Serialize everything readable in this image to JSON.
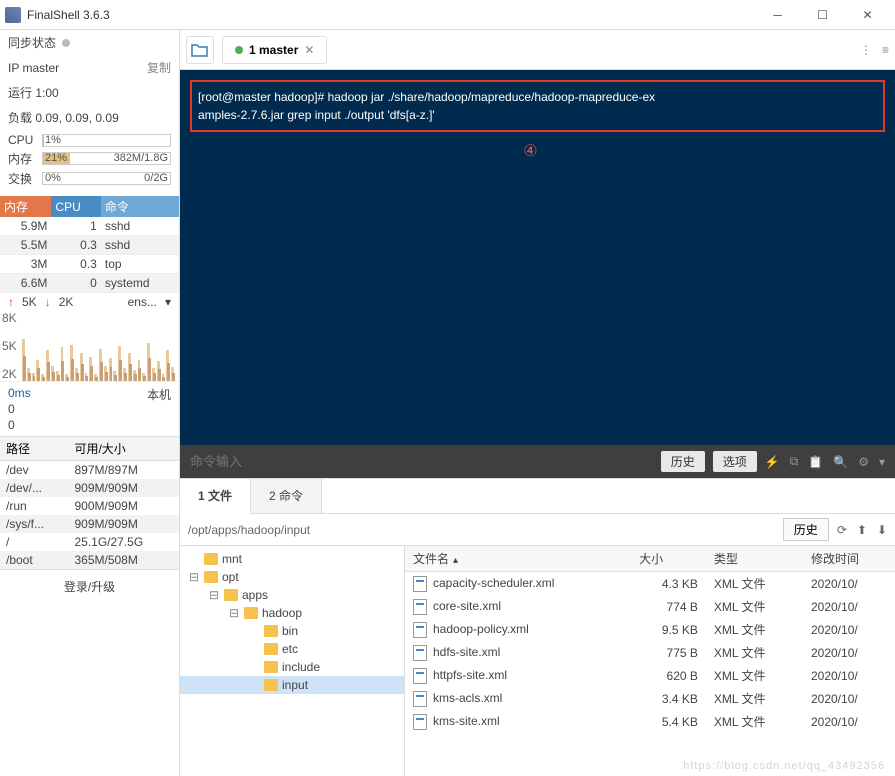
{
  "titlebar": {
    "title": "FinalShell 3.6.3"
  },
  "sidebar": {
    "sync_label": "同步状态",
    "ip_label": "IP master",
    "copy_label": "复制",
    "uptime_label": "运行 1:00",
    "load_label": "负载 0.09, 0.09, 0.09",
    "cpu": {
      "label": "CPU",
      "pct": "1%",
      "pct_num": 1
    },
    "mem": {
      "label": "内存",
      "pct": "21%",
      "pct_num": 21,
      "extra": "382M/1.8G"
    },
    "swap": {
      "label": "交换",
      "pct": "0%",
      "pct_num": 0,
      "extra": "0/2G"
    },
    "proc_headers": [
      "内存",
      "CPU",
      "命令"
    ],
    "procs": [
      {
        "mem": "5.9M",
        "cpu": "1",
        "cmd": "sshd"
      },
      {
        "mem": "5.5M",
        "cpu": "0.3",
        "cmd": "sshd"
      },
      {
        "mem": "3M",
        "cpu": "0.3",
        "cmd": "top"
      },
      {
        "mem": "6.6M",
        "cpu": "0",
        "cmd": "systemd"
      }
    ],
    "net_up": "5K",
    "net_down": "2K",
    "net_iface": "ens...",
    "spark_labels": [
      "8K",
      "5K",
      "2K"
    ],
    "latency": {
      "ms": "0ms",
      "host": "本机",
      "v1": "0",
      "v2": "0"
    },
    "disk_headers": [
      "路径",
      "可用/大小"
    ],
    "disks": [
      {
        "path": "/dev",
        "size": "897M/897M"
      },
      {
        "path": "/dev/...",
        "size": "909M/909M"
      },
      {
        "path": "/run",
        "size": "900M/909M"
      },
      {
        "path": "/sys/f...",
        "size": "909M/909M"
      },
      {
        "path": "/",
        "size": "25.1G/27.5G"
      },
      {
        "path": "/boot",
        "size": "365M/508M"
      }
    ],
    "login": "登录/升级"
  },
  "tabs": {
    "label": "1 master"
  },
  "terminal": {
    "line1": "[root@master hadoop]# hadoop jar ./share/hadoop/mapreduce/hadoop-mapreduce-ex",
    "line2": "amples-2.7.6.jar grep input ./output 'dfs[a-z.]'",
    "annotation": "④"
  },
  "cmdbar": {
    "placeholder": "命令输入",
    "history": "历史",
    "options": "选项"
  },
  "bottom_tabs": {
    "tab1": "1 文件",
    "tab2": "2 命令"
  },
  "pathbar": {
    "path": "/opt/apps/hadoop/input",
    "history": "历史"
  },
  "tree": [
    {
      "depth": 0,
      "toggle": "",
      "label": "mnt"
    },
    {
      "depth": 0,
      "toggle": "⊟",
      "label": "opt"
    },
    {
      "depth": 1,
      "toggle": "⊟",
      "label": "apps"
    },
    {
      "depth": 2,
      "toggle": "⊟",
      "label": "hadoop"
    },
    {
      "depth": 3,
      "toggle": "",
      "label": "bin"
    },
    {
      "depth": 3,
      "toggle": "",
      "label": "etc"
    },
    {
      "depth": 3,
      "toggle": "",
      "label": "include"
    },
    {
      "depth": 3,
      "toggle": "",
      "label": "input",
      "sel": true
    }
  ],
  "files": {
    "headers": [
      "文件名",
      "大小",
      "类型",
      "修改时间"
    ],
    "rows": [
      {
        "name": "capacity-scheduler.xml",
        "size": "4.3 KB",
        "type": "XML 文件",
        "mtime": "2020/10/"
      },
      {
        "name": "core-site.xml",
        "size": "774 B",
        "type": "XML 文件",
        "mtime": "2020/10/"
      },
      {
        "name": "hadoop-policy.xml",
        "size": "9.5 KB",
        "type": "XML 文件",
        "mtime": "2020/10/"
      },
      {
        "name": "hdfs-site.xml",
        "size": "775 B",
        "type": "XML 文件",
        "mtime": "2020/10/"
      },
      {
        "name": "httpfs-site.xml",
        "size": "620 B",
        "type": "XML 文件",
        "mtime": "2020/10/"
      },
      {
        "name": "kms-acls.xml",
        "size": "3.4 KB",
        "type": "XML 文件",
        "mtime": "2020/10/"
      },
      {
        "name": "kms-site.xml",
        "size": "5.4 KB",
        "type": "XML 文件",
        "mtime": "2020/10/"
      }
    ]
  },
  "watermark": "https://blog.csdn.net/qq_43492356"
}
